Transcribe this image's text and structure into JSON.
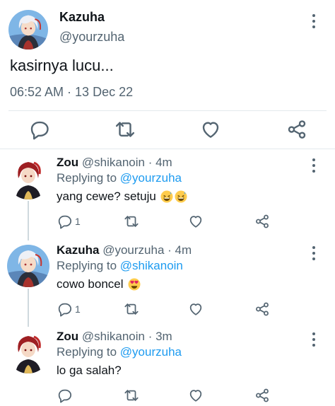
{
  "main_tweet": {
    "author_name": "Kazuha",
    "author_handle": "@yourzuha",
    "text": "kasirnya lucu...",
    "timestamp": "06:52 AM · 13 Dec 22",
    "actions": [
      "reply-icon",
      "retweet-icon",
      "like-icon",
      "share-icon"
    ]
  },
  "replies": [
    {
      "name": "Zou",
      "handle": "@shikanoin",
      "time": "4m",
      "replying_label": "Replying to",
      "replying_to": "@yourzuha",
      "text": "yang cewe? setuju",
      "emoji": [
        "grinning-sweat-emoji",
        "grinning-sweat-emoji"
      ],
      "reply_count": "1"
    },
    {
      "name": "Kazuha",
      "handle": "@yourzuha",
      "time": "4m",
      "replying_label": "Replying to",
      "replying_to": "@shikanoin",
      "text": "cowo boncel",
      "emoji": [
        "heart-eyes-emoji"
      ],
      "reply_count": "1"
    },
    {
      "name": "Zou",
      "handle": "@shikanoin",
      "time": "3m",
      "replying_label": "Replying to",
      "replying_to": "@yourzuha",
      "text": "lo ga salah?",
      "emoji": [],
      "reply_count": ""
    }
  ],
  "colors": {
    "text": "#0f1419",
    "muted": "#536471",
    "link": "#1d9bf0",
    "divider": "#e4e9ed",
    "thread_line": "#cfd9de"
  }
}
